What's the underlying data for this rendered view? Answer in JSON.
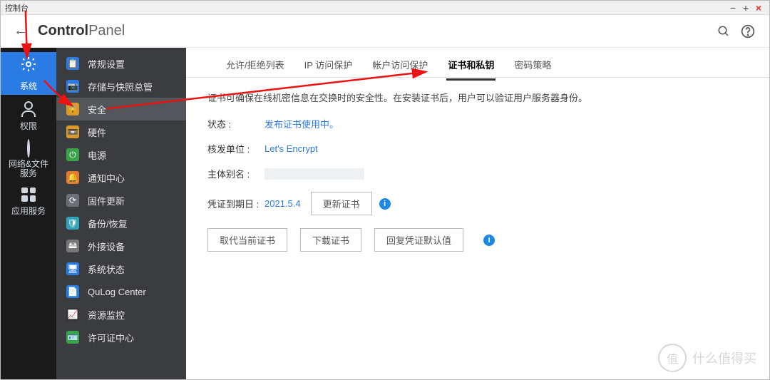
{
  "window": {
    "title": "控制台"
  },
  "header": {
    "title_bold": "Control",
    "title_thin": "Panel"
  },
  "nav1": [
    {
      "name": "system",
      "label": "系统",
      "active": true
    },
    {
      "name": "privileges",
      "label": "权限",
      "active": false
    },
    {
      "name": "network",
      "label": "网络&文件\n服务",
      "active": false
    },
    {
      "name": "apps",
      "label": "应用服务",
      "active": false
    }
  ],
  "nav2": [
    {
      "name": "general",
      "label": "常规设置",
      "color": "#2b7be4"
    },
    {
      "name": "storage-snapshot",
      "label": "存储与快照总管",
      "color": "#2b7be4"
    },
    {
      "name": "security",
      "label": "安全",
      "color": "#d99a2b",
      "active": true
    },
    {
      "name": "hardware",
      "label": "硬件",
      "color": "#d99a2b"
    },
    {
      "name": "power",
      "label": "电源",
      "color": "#3aa24a"
    },
    {
      "name": "notification",
      "label": "通知中心",
      "color": "#e27b2f"
    },
    {
      "name": "firmware",
      "label": "固件更新",
      "color": "#6b6f76"
    },
    {
      "name": "backup-restore",
      "label": "备份/恢复",
      "color": "#2fa3b8"
    },
    {
      "name": "external-device",
      "label": "外接设备",
      "color": "#777"
    },
    {
      "name": "system-status",
      "label": "系统状态",
      "color": "#2b7be4"
    },
    {
      "name": "qulog",
      "label": "QuLog Center",
      "color": "#2b7be4"
    },
    {
      "name": "resource-monitor",
      "label": "资源监控",
      "color": "#333"
    },
    {
      "name": "license",
      "label": "许可证中心",
      "color": "#3aa24a"
    }
  ],
  "tabs": [
    {
      "name": "allow-deny",
      "label": "允许/拒绝列表"
    },
    {
      "name": "ip-access",
      "label": "IP 访问保护"
    },
    {
      "name": "account-access",
      "label": "帐户访问保护"
    },
    {
      "name": "cert-key",
      "label": "证书和私钥",
      "active": true
    },
    {
      "name": "password-policy",
      "label": "密码策略"
    }
  ],
  "content": {
    "description": "证书可确保在线机密信息在交换时的安全性。在安装证书后，用户可以验证用户服务器身份。",
    "rows": {
      "status_label": "状态",
      "status_value": "发布证书使用中。",
      "issuer_label": "核发单位",
      "issuer_value": "Let's Encrypt",
      "san_label": "主体别名",
      "expiry_label": "凭证到期日",
      "expiry_value": "2021.5.4",
      "renew_btn": "更新证书"
    },
    "buttons": {
      "replace": "取代当前证书",
      "download": "下载证书",
      "restore": "回复凭证默认值"
    }
  },
  "watermark": {
    "badge": "值",
    "text": "什么值得买"
  }
}
